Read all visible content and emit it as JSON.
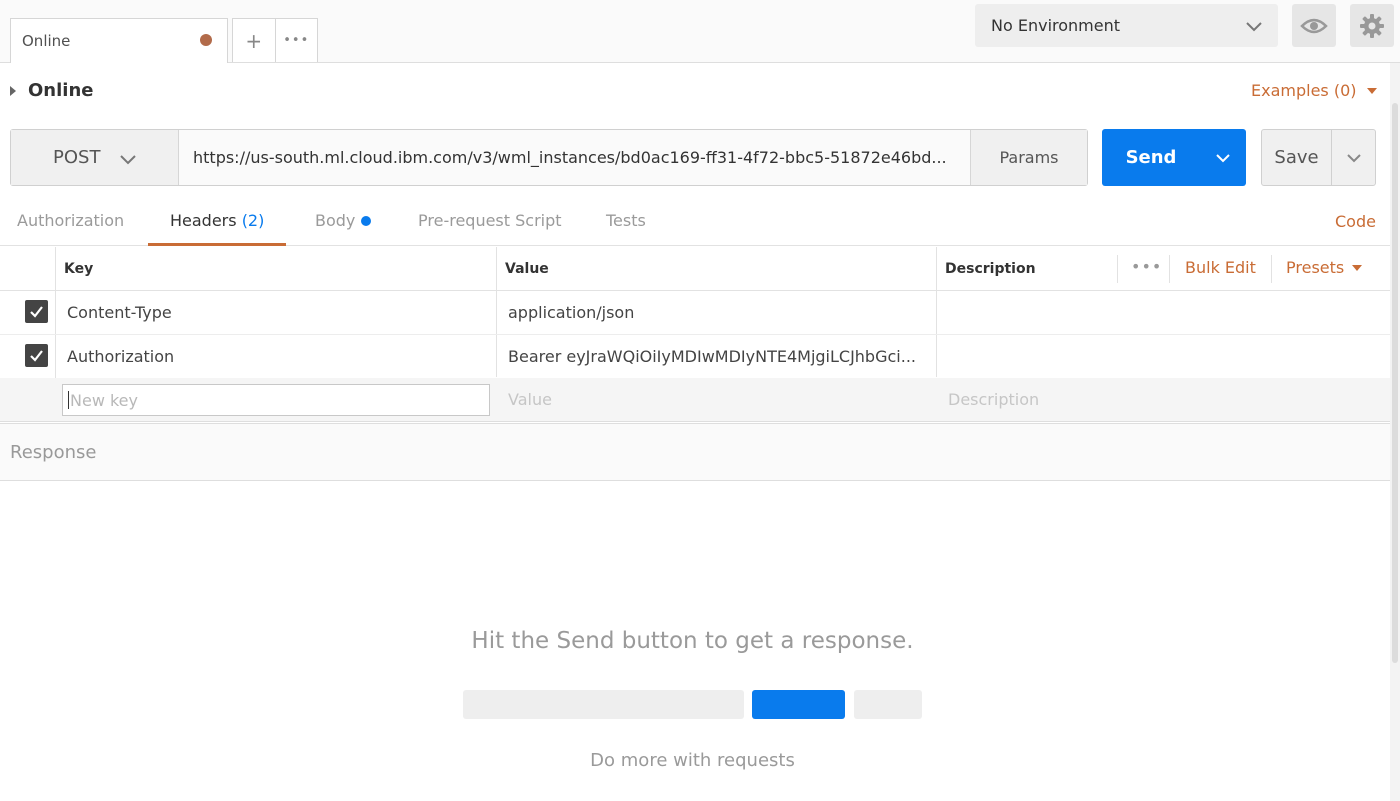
{
  "tabs": {
    "active_tab_label": "Online",
    "add_symbol": "+",
    "more_symbol": "•••"
  },
  "environment": {
    "selected": "No Environment"
  },
  "request": {
    "name": "Online",
    "examples_label": "Examples (0)",
    "method": "POST",
    "url": "https://us-south.ml.cloud.ibm.com/v3/wml_instances/bd0ac169-ff31-4f72-bbc5-51872e46bd...",
    "params_label": "Params",
    "send_label": "Send",
    "save_label": "Save"
  },
  "subtabs": {
    "authorization": "Authorization",
    "headers": "Headers",
    "headers_count": "(2)",
    "body": "Body",
    "prerequest": "Pre-request Script",
    "tests": "Tests",
    "code": "Code"
  },
  "headers_table": {
    "columns": {
      "key": "Key",
      "value": "Value",
      "description": "Description"
    },
    "more_label": "•••",
    "bulk_edit": "Bulk Edit",
    "presets": "Presets",
    "rows": [
      {
        "key": "Content-Type",
        "value": "application/json",
        "description": "",
        "checked": true
      },
      {
        "key": "Authorization",
        "value": "Bearer eyJraWQiOiIyMDIwMDIyNTE4MjgiLCJhbGci...",
        "description": "",
        "checked": true
      }
    ],
    "placeholders": {
      "key": "New key",
      "value": "Value",
      "description": "Description"
    }
  },
  "response": {
    "title": "Response",
    "empty_message": "Hit the Send button to get a response.",
    "do_more": "Do more with requests"
  },
  "colors": {
    "accent": "#c96c35",
    "send_blue": "#097bed",
    "unsaved_dot": "#b26b4a"
  },
  "icons": [
    "chevron-down-icon",
    "eye-icon",
    "gear-icon",
    "checkbox-checked-icon",
    "caret-right-icon"
  ]
}
